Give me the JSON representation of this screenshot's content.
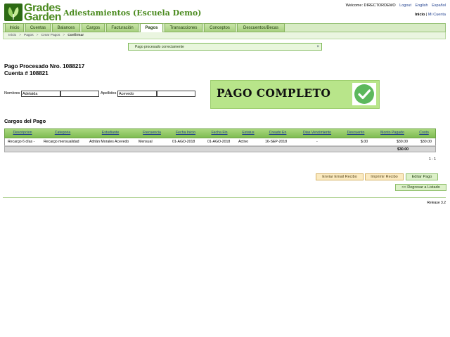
{
  "header": {
    "brand_line1": "Grades",
    "brand_line2": "Garden",
    "school_name": "Adiestamientos (Escuela Demo)",
    "welcome": "Welcome: DIRECTORDEMO",
    "logout": "Logout",
    "lang_en": "English",
    "lang_es": "Español",
    "home_link": "Inicio",
    "account_sep": "|",
    "my_account": "Mi Cuenta"
  },
  "menu": {
    "tabs": [
      {
        "label": "Inicio"
      },
      {
        "label": "Cuentas"
      },
      {
        "label": "Balances"
      },
      {
        "label": "Cargos"
      },
      {
        "label": "Facturación"
      },
      {
        "label": "Pagos"
      },
      {
        "label": "Transacciones"
      },
      {
        "label": "Conceptos"
      },
      {
        "label": "Descuentos/Becas"
      }
    ],
    "active": "Pagos"
  },
  "breadcrumb": [
    "Inicio",
    "Pagos",
    "Crear Pagos",
    "Confirmar"
  ],
  "breadcrumb_sep": ">",
  "message": {
    "text": "Pago procesado correctamente",
    "close": "×"
  },
  "payment": {
    "title": "Pago Procesado Nro. 1088217",
    "account": "Cuenta # 108821",
    "nombres_label": "Nombres",
    "nombres_value": "Adelaida",
    "nombres_value2": "",
    "apellidos_label": "Apellidos",
    "apellidos_value": "Acevedo",
    "apellidos_value2": "",
    "banner": "PAGO COMPLETO",
    "banner_color": "#b8e58a",
    "banner_icon": "check-circle-icon",
    "check_color": "#5cb85c"
  },
  "charges": {
    "title": "Cargos del Pago",
    "columns": [
      "Descripcion",
      "Categoria",
      "Estudiante",
      "Frecuencia",
      "Fecha Inicio",
      "Fecha Fin",
      "Estatus",
      "Creado En",
      "Dias Vencimiento",
      "Descuento",
      "Monto Pagado",
      "Costo"
    ],
    "rows": [
      [
        "Recargo 6 días -",
        "Recargo mensualidad",
        "Adrián Morales Acevedo",
        "Mensual",
        "01-AGO-2018",
        "01-AGO-2018",
        "Activo",
        "16-SEP-2018",
        "-",
        "$.00",
        "$30.00",
        "$30.00"
      ]
    ],
    "total": "$30.00",
    "pager": "1 - 1"
  },
  "actions": {
    "email": "Enviar Email Recibo",
    "print": "Imprimir Recibo",
    "edit": "Editar Pago",
    "back": "<< Regresar a Listado"
  },
  "footer": {
    "release": "Release 3.2"
  },
  "colors": {
    "brand": "#4a8a1e",
    "menu": "#a8d080",
    "link": "#1f3f8f"
  }
}
